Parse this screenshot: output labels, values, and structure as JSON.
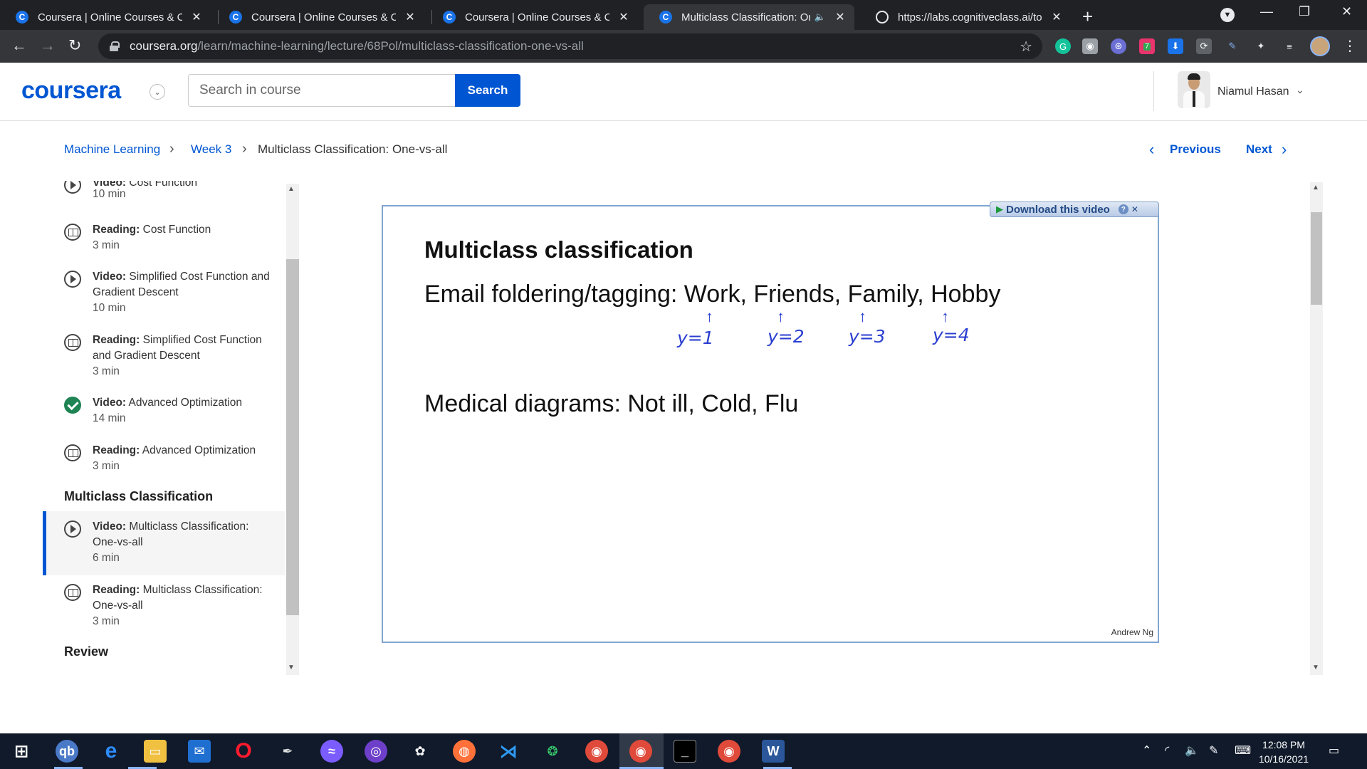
{
  "browser": {
    "tabs": [
      {
        "title": "Coursera | Online Courses & Credentials",
        "favicon": "C"
      },
      {
        "title": "Coursera | Online Courses & Credentials",
        "favicon": "C"
      },
      {
        "title": "Coursera | Online Courses & Credentials",
        "favicon": "C"
      },
      {
        "title": "Multiclass Classification: One-vs-all",
        "favicon": "C",
        "active": true,
        "audio": true
      },
      {
        "title": "https://labs.cognitiveclass.ai/tools",
        "favicon": "globe"
      }
    ],
    "url_host": "coursera.org",
    "url_path": "/learn/machine-learning/lecture/68Pol/multiclass-classification-one-vs-all",
    "extension_badge": "7"
  },
  "header": {
    "logo": "coursera",
    "search_placeholder": "Search in course",
    "search_button": "Search",
    "user_name": "Niamul Hasan"
  },
  "breadcrumb": {
    "items": [
      "Machine Learning",
      "Week 3",
      "Multiclass Classification: One-vs-all"
    ],
    "previous": "Previous",
    "next": "Next"
  },
  "sidebar": {
    "items": [
      {
        "type": "Video:",
        "title": "Cost Function",
        "duration": "10 min",
        "icon": "play-icon"
      },
      {
        "type": "Reading:",
        "title": "Cost Function",
        "duration": "3 min",
        "icon": "book-icon"
      },
      {
        "type": "Video:",
        "title": "Simplified Cost Function and Gradient Descent",
        "duration": "10 min",
        "icon": "play-icon"
      },
      {
        "type": "Reading:",
        "title": "Simplified Cost Function and Gradient Descent",
        "duration": "3 min",
        "icon": "book-icon"
      },
      {
        "type": "Video:",
        "title": "Advanced Optimization",
        "duration": "14 min",
        "icon": "check-icon",
        "completed": true
      },
      {
        "type": "Reading:",
        "title": "Advanced Optimization",
        "duration": "3 min",
        "icon": "book-icon"
      }
    ],
    "section": "Multiclass Classification",
    "section_items": [
      {
        "type": "Video:",
        "title": "Multiclass Classification: One-vs-all",
        "duration": "6 min",
        "icon": "play-icon",
        "active": true
      },
      {
        "type": "Reading:",
        "title": "Multiclass Classification: One-vs-all",
        "duration": "3 min",
        "icon": "book-icon"
      }
    ],
    "next_section": "Review"
  },
  "video": {
    "download_label": "Download this video",
    "slide_title": "Multiclass classification",
    "line1": "Email foldering/tagging: Work, Friends, Family, Hobby",
    "annotations": [
      "y=1",
      "y=2",
      "y=3",
      "y=4"
    ],
    "line2": "Medical diagrams: Not ill, Cold, Flu",
    "credit": "Andrew Ng"
  },
  "taskbar": {
    "time": "12:08 PM",
    "date": "10/16/2021"
  },
  "colors": {
    "accent": "#0056d2",
    "completed": "#1f8354",
    "handwriting": "#2b3fd0"
  }
}
